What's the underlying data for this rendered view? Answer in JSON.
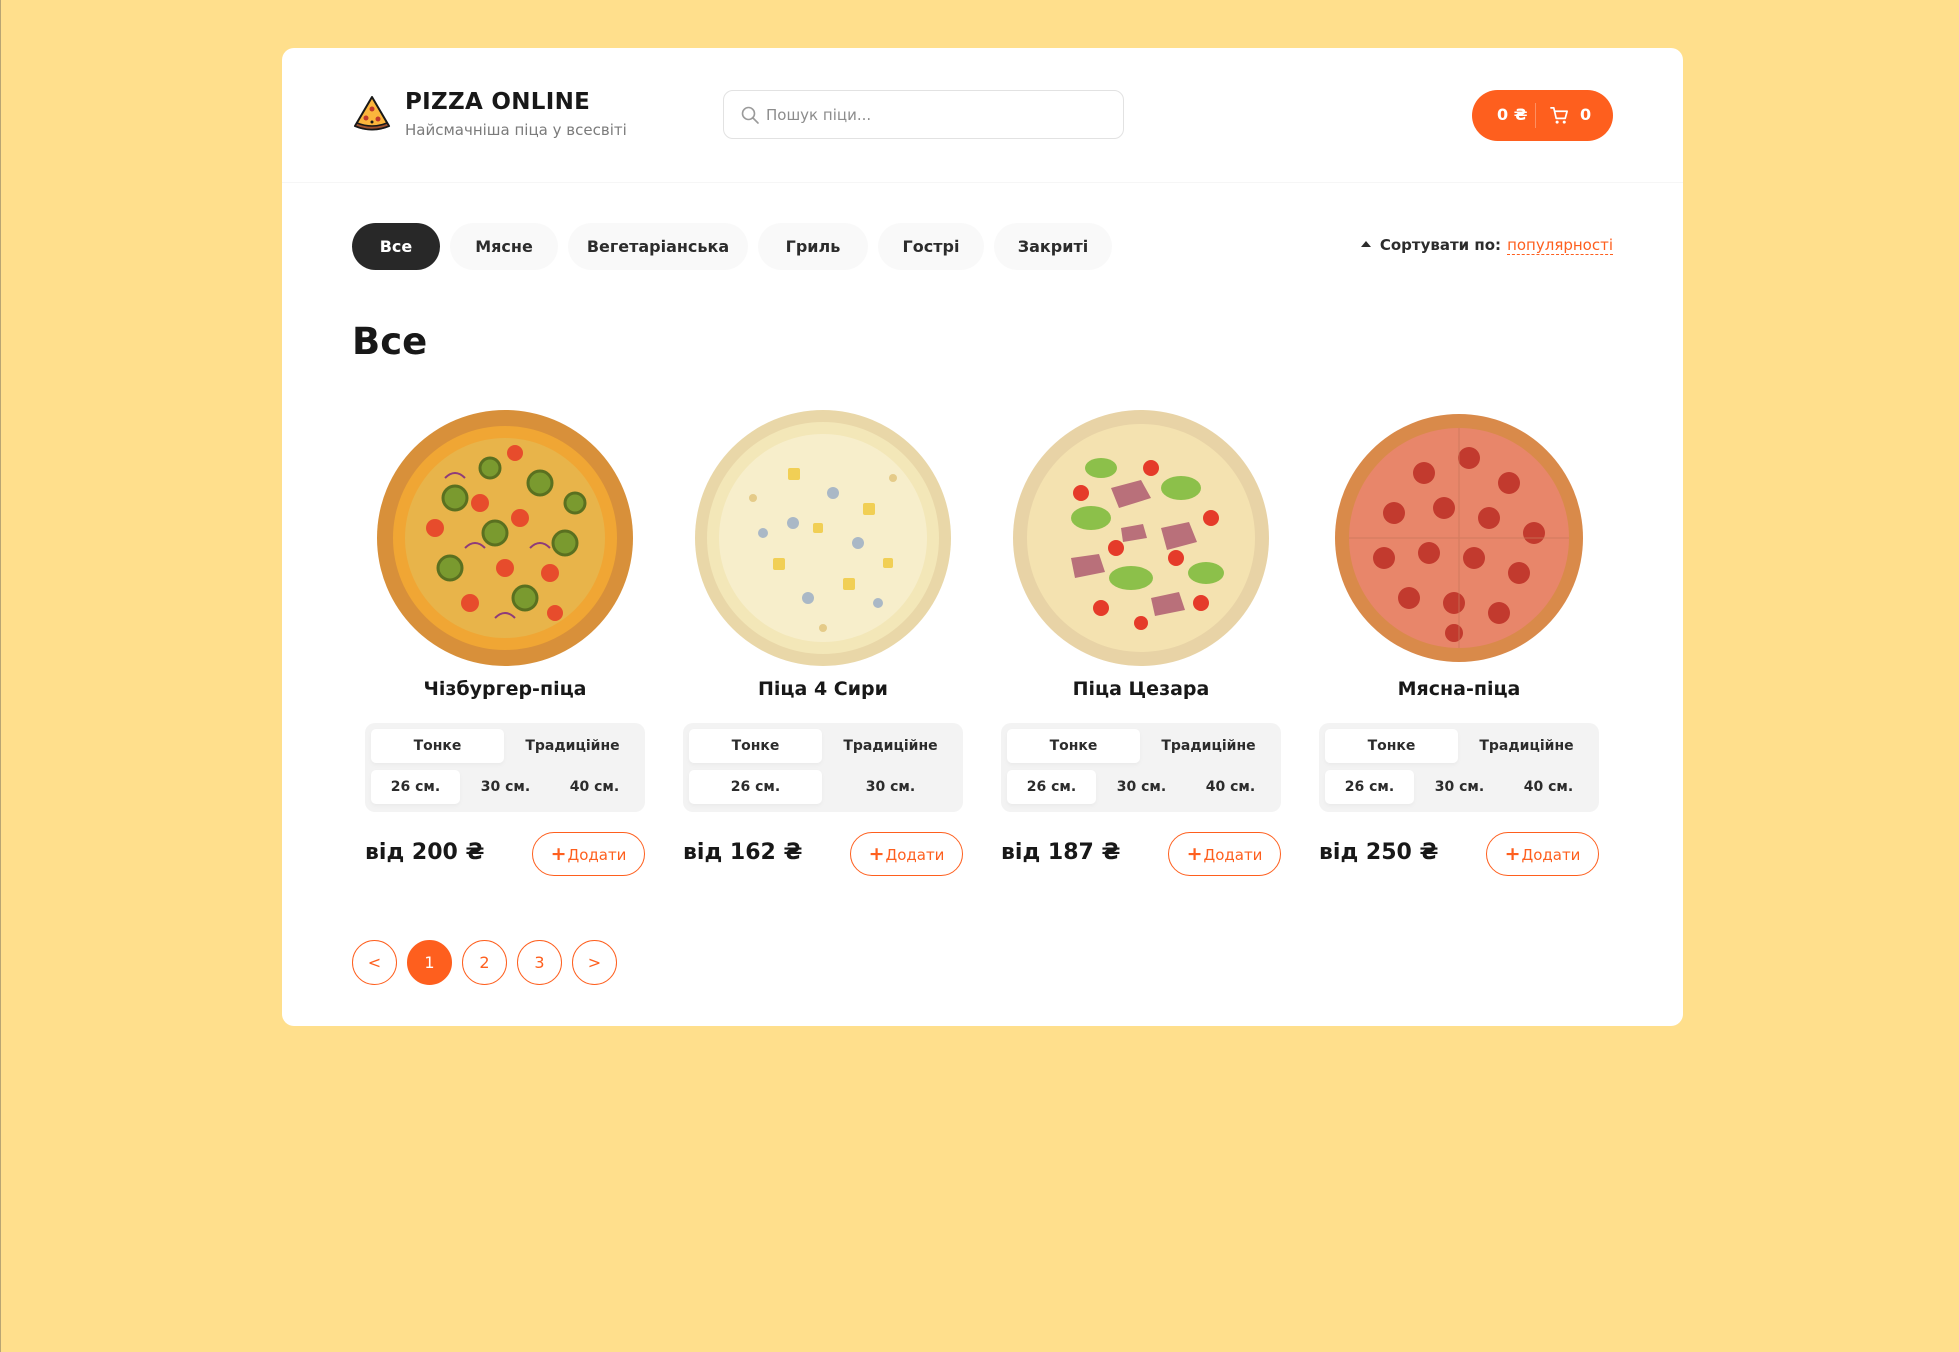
{
  "brand": {
    "title": "PIZZA ONLINE",
    "subtitle": "Найсмачніша піца у всесвіті"
  },
  "search": {
    "placeholder": "Пошук піци...",
    "value": ""
  },
  "cart": {
    "total": "0 ₴",
    "count": "0"
  },
  "categories": [
    {
      "label": "Все",
      "active": true
    },
    {
      "label": "Мясне",
      "active": false
    },
    {
      "label": "Вегетаріанська",
      "active": false
    },
    {
      "label": "Гриль",
      "active": false
    },
    {
      "label": "Гострі",
      "active": false
    },
    {
      "label": "Закриті",
      "active": false
    }
  ],
  "sort": {
    "label": "Сортувати по:",
    "value": "популярності"
  },
  "section_title": "Все",
  "pizzas": [
    {
      "name": "Чізбургер-піца",
      "types": [
        "Тонке",
        "Традиційне"
      ],
      "active_type": 0,
      "sizes": [
        "26 см.",
        "30 см.",
        "40 см."
      ],
      "active_size": 0,
      "price": "від 200 ₴",
      "add_label": "Додати",
      "image": "cheeseburger-pizza"
    },
    {
      "name": "Піца 4 Сири",
      "types": [
        "Тонке",
        "Традиційне"
      ],
      "active_type": 0,
      "sizes": [
        "26 см.",
        "30 см."
      ],
      "active_size": 0,
      "price": "від 162 ₴",
      "add_label": "Додати",
      "image": "four-cheese-pizza"
    },
    {
      "name": "Піца Цезара",
      "types": [
        "Тонке",
        "Традиційне"
      ],
      "active_type": 0,
      "sizes": [
        "26 см.",
        "30 см.",
        "40 см."
      ],
      "active_size": 0,
      "price": "від 187 ₴",
      "add_label": "Додати",
      "image": "caesar-pizza"
    },
    {
      "name": "Мясна-піца",
      "types": [
        "Тонке",
        "Традиційне"
      ],
      "active_type": 0,
      "sizes": [
        "26 см.",
        "30 см.",
        "40 см."
      ],
      "active_size": 0,
      "price": "від 250 ₴",
      "add_label": "Додати",
      "image": "pepperoni-pizza"
    }
  ],
  "pagination": {
    "prev": "<",
    "pages": [
      "1",
      "2",
      "3"
    ],
    "active_page": "1",
    "next": ">"
  },
  "colors": {
    "background": "#ffdf8c",
    "accent": "#fe5f1e",
    "dark": "#282828"
  }
}
